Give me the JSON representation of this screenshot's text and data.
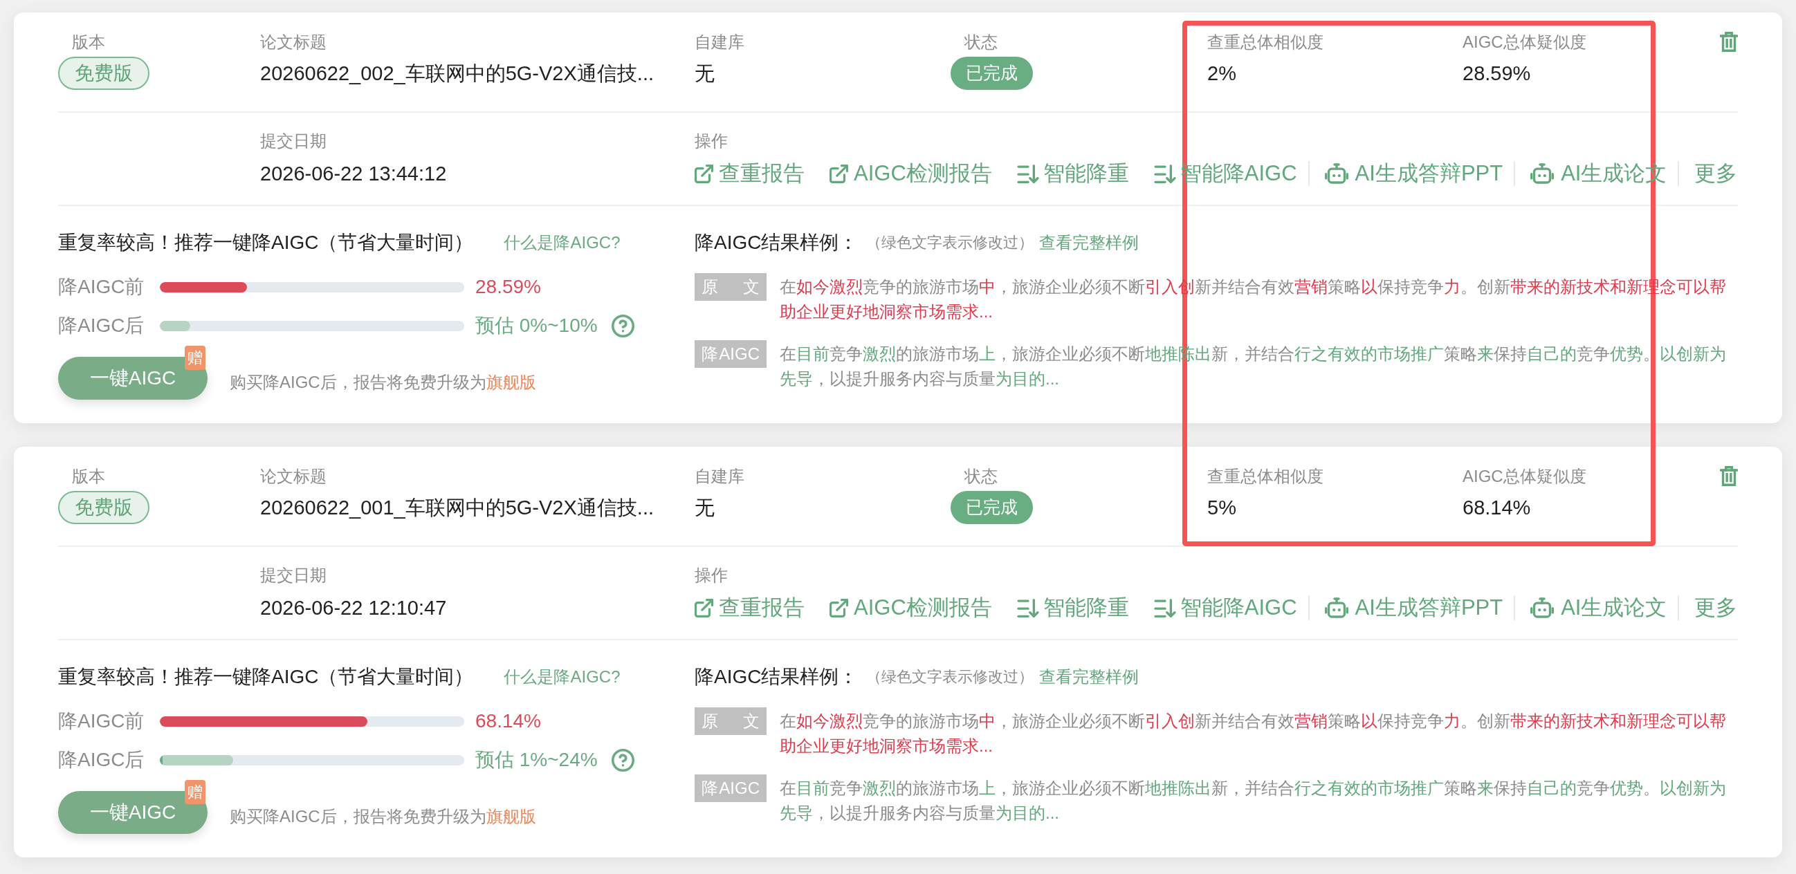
{
  "records": [
    {
      "summary": {
        "version": {
          "label": "版本",
          "value": "免费版"
        },
        "title": {
          "label": "论文标题",
          "value": "20260622_002_车联网中的5G-V2X通信技..."
        },
        "library": {
          "label": "自建库",
          "value": "无"
        },
        "status": {
          "label": "状态",
          "value": "已完成"
        },
        "plagiarism": {
          "label": "查重总体相似度",
          "value": "2%"
        },
        "aigc": {
          "label": "AIGC总体疑似度",
          "value": "28.59%"
        }
      },
      "submitted": {
        "label": "提交日期",
        "value": "2026-06-22 13:44:12"
      },
      "actions": {
        "label": "操作",
        "items": [
          {
            "kind": "external",
            "label": "查重报告"
          },
          {
            "kind": "external",
            "label": "AIGC检测报告"
          },
          {
            "kind": "sort",
            "label": "智能降重"
          },
          {
            "kind": "sort",
            "label": "智能降AIGC"
          },
          {
            "kind": "robot",
            "label": "AI生成答辩PPT"
          },
          {
            "kind": "robot",
            "label": "AI生成论文"
          },
          {
            "kind": "more",
            "label": "更多"
          }
        ]
      },
      "recommendation": {
        "headline": "重复率较高！推荐一键降AIGC（节省大量时间）",
        "help_link": "什么是降AIGC?",
        "before": {
          "label": "降AIGC前",
          "level": 0.2859,
          "reading": "28.59%"
        },
        "after": {
          "label": "降AIGC后",
          "high": {
            "level": 0.1
          },
          "reading": "预估 0%~10%"
        },
        "button": {
          "label": "一键AIGC",
          "badge": "赠"
        },
        "note": {
          "text": "购买降AIGC后，报告将免费升级为",
          "highlight": "旗舰版"
        }
      },
      "sample": {
        "title": "降AIGC结果样例：",
        "hint": "（绿色文字表示修改过）",
        "link": "查看完整样例",
        "rows": [
          {
            "kind": "original",
            "tag": "原 文",
            "segments": [
              {
                "text": "在",
                "changed": false
              },
              {
                "text": "如今激烈",
                "changed": true
              },
              {
                "text": "竞争的旅游市场",
                "changed": false
              },
              {
                "text": "中",
                "changed": true
              },
              {
                "text": "，旅游企业必须不断",
                "changed": false
              },
              {
                "text": "引入创",
                "changed": true
              },
              {
                "text": "新并结合有效",
                "changed": false
              },
              {
                "text": "营销",
                "changed": true
              },
              {
                "text": "策略",
                "changed": false
              },
              {
                "text": "以",
                "changed": true
              },
              {
                "text": "保持竞争",
                "changed": false
              },
              {
                "text": "力",
                "changed": true
              },
              {
                "text": "。创新",
                "changed": false
              },
              {
                "text": "带来的新技术和新理念可以帮助企业更好地洞察市场需求...",
                "changed": true
              }
            ]
          },
          {
            "kind": "rewritten",
            "tag": "降AIGC",
            "segments": [
              {
                "text": "在",
                "changed": false
              },
              {
                "text": "目前",
                "changed": true
              },
              {
                "text": "竞争",
                "changed": false
              },
              {
                "text": "激烈",
                "changed": true
              },
              {
                "text": "的旅游市场",
                "changed": false
              },
              {
                "text": "上",
                "changed": true
              },
              {
                "text": "，旅游企业必须不断",
                "changed": false
              },
              {
                "text": "地推陈出",
                "changed": true
              },
              {
                "text": "新，并结合",
                "changed": false
              },
              {
                "text": "行之有效的市场推广",
                "changed": true
              },
              {
                "text": "策略",
                "changed": false
              },
              {
                "text": "来",
                "changed": true
              },
              {
                "text": "保持",
                "changed": false
              },
              {
                "text": "自己的",
                "changed": true
              },
              {
                "text": "竞争",
                "changed": false
              },
              {
                "text": "优势",
                "changed": true
              },
              {
                "text": "。",
                "changed": false
              },
              {
                "text": "以创新为先导",
                "changed": true
              },
              {
                "text": "，以提升服务内容与质量",
                "changed": false
              },
              {
                "text": "为目的...",
                "changed": true
              }
            ]
          }
        ]
      }
    },
    {
      "summary": {
        "version": {
          "label": "版本",
          "value": "免费版"
        },
        "title": {
          "label": "论文标题",
          "value": "20260622_001_车联网中的5G-V2X通信技..."
        },
        "library": {
          "label": "自建库",
          "value": "无"
        },
        "status": {
          "label": "状态",
          "value": "已完成"
        },
        "plagiarism": {
          "label": "查重总体相似度",
          "value": "5%"
        },
        "aigc": {
          "label": "AIGC总体疑似度",
          "value": "68.14%"
        }
      },
      "submitted": {
        "label": "提交日期",
        "value": "2026-06-22 12:10:47"
      },
      "actions": {
        "label": "操作",
        "items": [
          {
            "kind": "external",
            "label": "查重报告"
          },
          {
            "kind": "external",
            "label": "AIGC检测报告"
          },
          {
            "kind": "sort",
            "label": "智能降重"
          },
          {
            "kind": "sort",
            "label": "智能降AIGC"
          },
          {
            "kind": "robot",
            "label": "AI生成答辩PPT"
          },
          {
            "kind": "robot",
            "label": "AI生成论文"
          },
          {
            "kind": "more",
            "label": "更多"
          }
        ]
      },
      "recommendation": {
        "headline": "重复率较高！推荐一键降AIGC（节省大量时间）",
        "help_link": "什么是降AIGC?",
        "before": {
          "label": "降AIGC前",
          "level": 0.6814,
          "reading": "68.14%"
        },
        "after": {
          "label": "降AIGC后",
          "low": {
            "level": 0.01
          },
          "high": {
            "level": 0.24
          },
          "reading": "预估 1%~24%"
        },
        "button": {
          "label": "一键AIGC",
          "badge": "赠"
        },
        "note": {
          "text": "购买降AIGC后，报告将免费升级为",
          "highlight": "旗舰版"
        }
      },
      "sample": {
        "title": "降AIGC结果样例：",
        "hint": "（绿色文字表示修改过）",
        "link": "查看完整样例",
        "rows": [
          {
            "kind": "original",
            "tag": "原 文",
            "segments": [
              {
                "text": "在",
                "changed": false
              },
              {
                "text": "如今激烈",
                "changed": true
              },
              {
                "text": "竞争的旅游市场",
                "changed": false
              },
              {
                "text": "中",
                "changed": true
              },
              {
                "text": "，旅游企业必须不断",
                "changed": false
              },
              {
                "text": "引入创",
                "changed": true
              },
              {
                "text": "新并结合有效",
                "changed": false
              },
              {
                "text": "营销",
                "changed": true
              },
              {
                "text": "策略",
                "changed": false
              },
              {
                "text": "以",
                "changed": true
              },
              {
                "text": "保持竞争",
                "changed": false
              },
              {
                "text": "力",
                "changed": true
              },
              {
                "text": "。创新",
                "changed": false
              },
              {
                "text": "带来的新技术和新理念可以帮助企业更好地洞察市场需求...",
                "changed": true
              }
            ]
          },
          {
            "kind": "rewritten",
            "tag": "降AIGC",
            "segments": [
              {
                "text": "在",
                "changed": false
              },
              {
                "text": "目前",
                "changed": true
              },
              {
                "text": "竞争",
                "changed": false
              },
              {
                "text": "激烈",
                "changed": true
              },
              {
                "text": "的旅游市场",
                "changed": false
              },
              {
                "text": "上",
                "changed": true
              },
              {
                "text": "，旅游企业必须不断",
                "changed": false
              },
              {
                "text": "地推陈出",
                "changed": true
              },
              {
                "text": "新，并结合",
                "changed": false
              },
              {
                "text": "行之有效的市场推广",
                "changed": true
              },
              {
                "text": "策略",
                "changed": false
              },
              {
                "text": "来",
                "changed": true
              },
              {
                "text": "保持",
                "changed": false
              },
              {
                "text": "自己的",
                "changed": true
              },
              {
                "text": "竞争",
                "changed": false
              },
              {
                "text": "优势",
                "changed": true
              },
              {
                "text": "。",
                "changed": false
              },
              {
                "text": "以创新为先导",
                "changed": true
              },
              {
                "text": "，以提升服务内容与质量",
                "changed": false
              },
              {
                "text": "为目的...",
                "changed": true
              }
            ]
          }
        ]
      }
    }
  ]
}
